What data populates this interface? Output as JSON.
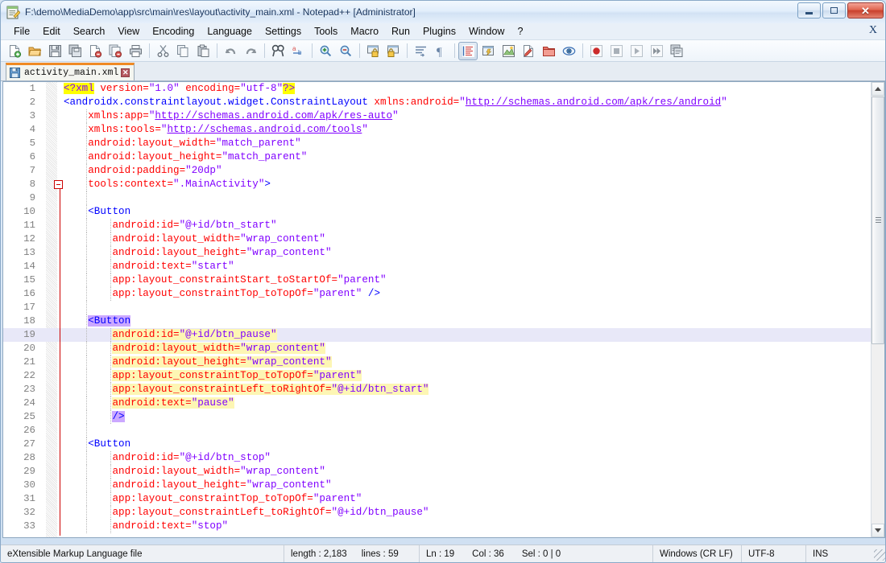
{
  "window": {
    "title": "F:\\demo\\MediaDemo\\app\\src\\main\\res\\layout\\activity_main.xml - Notepad++ [Administrator]",
    "app_icon": "notepad-plus-plus-icon",
    "minimize_label": "",
    "maximize_label": "",
    "close_label": "✕"
  },
  "menubar": {
    "items": [
      "File",
      "Edit",
      "Search",
      "View",
      "Encoding",
      "Language",
      "Settings",
      "Tools",
      "Macro",
      "Run",
      "Plugins",
      "Window",
      "?"
    ],
    "close_document_label": "X"
  },
  "toolbar": {
    "groups": [
      [
        "new-file-icon",
        "open-file-icon",
        "save-icon",
        "save-all-icon",
        "close-file-icon",
        "close-all-icon",
        "print-icon"
      ],
      [
        "cut-icon",
        "copy-icon",
        "paste-icon"
      ],
      [
        "undo-icon",
        "redo-icon"
      ],
      [
        "find-icon",
        "replace-icon"
      ],
      [
        "zoom-in-icon",
        "zoom-out-icon"
      ],
      [
        "sync-vertical-scroll-icon",
        "sync-horizontal-scroll-icon"
      ],
      [
        "word-wrap-icon",
        "show-all-characters-icon"
      ],
      [
        "show-indent-guide-icon",
        "show-ui-icon",
        "show-npp-icon",
        "macro-record-pen-icon",
        "open-folder-icon",
        "document-map-icon"
      ],
      [
        "start-recording-icon",
        "stop-recording-icon",
        "play-macro-icon",
        "run-macro-multiple-icon",
        "save-macro-icon"
      ]
    ],
    "active_button": "show-indent-guide-icon"
  },
  "tabs": [
    {
      "label": "activity_main.xml",
      "icon": "saved-file-floppy-icon",
      "close_label": "✕",
      "active": true
    }
  ],
  "editor": {
    "fold_marker_line": 8,
    "current_line": 19,
    "lines": [
      {
        "n": 1,
        "indent_guides": [],
        "tokens": [
          {
            "t": "<?",
            "c": "pi"
          },
          {
            "t": "xml",
            "c": "tag-pi"
          },
          {
            "t": " version=",
            "c": "attr"
          },
          {
            "t": "\"1.0\"",
            "c": "val"
          },
          {
            "t": " encoding=",
            "c": "attr"
          },
          {
            "t": "\"utf-8\"",
            "c": "val"
          },
          {
            "t": "?>",
            "c": "pi"
          }
        ]
      },
      {
        "n": 2,
        "indent_guides": [],
        "tokens": [
          {
            "t": "<androidx.constraintlayout.widget.ConstraintLayout",
            "c": "tag"
          },
          {
            "t": " xmlns:android=",
            "c": "attr"
          },
          {
            "t": "\"",
            "c": "val"
          },
          {
            "t": "http://schemas.android.com/apk/res/android",
            "c": "url"
          },
          {
            "t": "\"",
            "c": "val"
          }
        ]
      },
      {
        "n": 3,
        "indent_guides": [
          1
        ],
        "tokens": [
          {
            "t": "    xmlns:app=",
            "c": "attr"
          },
          {
            "t": "\"",
            "c": "val"
          },
          {
            "t": "http://schemas.android.com/apk/res-auto",
            "c": "url"
          },
          {
            "t": "\"",
            "c": "val"
          }
        ]
      },
      {
        "n": 4,
        "indent_guides": [
          1
        ],
        "tokens": [
          {
            "t": "    xmlns:tools=",
            "c": "attr"
          },
          {
            "t": "\"",
            "c": "val"
          },
          {
            "t": "http://schemas.android.com/tools",
            "c": "url"
          },
          {
            "t": "\"",
            "c": "val"
          }
        ]
      },
      {
        "n": 5,
        "indent_guides": [
          1
        ],
        "tokens": [
          {
            "t": "    android:layout_width=",
            "c": "attr"
          },
          {
            "t": "\"match_parent\"",
            "c": "val"
          }
        ]
      },
      {
        "n": 6,
        "indent_guides": [
          1
        ],
        "tokens": [
          {
            "t": "    android:layout_height=",
            "c": "attr"
          },
          {
            "t": "\"match_parent\"",
            "c": "val"
          }
        ]
      },
      {
        "n": 7,
        "indent_guides": [
          1
        ],
        "tokens": [
          {
            "t": "    android:padding=",
            "c": "attr"
          },
          {
            "t": "\"20dp\"",
            "c": "val"
          }
        ]
      },
      {
        "n": 8,
        "indent_guides": [
          1
        ],
        "fold": true,
        "tokens": [
          {
            "t": "    tools:context=",
            "c": "attr"
          },
          {
            "t": "\".MainActivity\"",
            "c": "val"
          },
          {
            "t": ">",
            "c": "tag"
          }
        ]
      },
      {
        "n": 9,
        "indent_guides": [
          1
        ],
        "tokens": []
      },
      {
        "n": 10,
        "indent_guides": [
          1
        ],
        "tokens": [
          {
            "t": "    <Button",
            "c": "tag"
          }
        ]
      },
      {
        "n": 11,
        "indent_guides": [
          1,
          2
        ],
        "tokens": [
          {
            "t": "        android:id=",
            "c": "attr"
          },
          {
            "t": "\"@+id/btn_start\"",
            "c": "val"
          }
        ]
      },
      {
        "n": 12,
        "indent_guides": [
          1,
          2
        ],
        "tokens": [
          {
            "t": "        android:layout_width=",
            "c": "attr"
          },
          {
            "t": "\"wrap_content\"",
            "c": "val"
          }
        ]
      },
      {
        "n": 13,
        "indent_guides": [
          1,
          2
        ],
        "tokens": [
          {
            "t": "        android:layout_height=",
            "c": "attr"
          },
          {
            "t": "\"wrap_content\"",
            "c": "val"
          }
        ]
      },
      {
        "n": 14,
        "indent_guides": [
          1,
          2
        ],
        "tokens": [
          {
            "t": "        android:text=",
            "c": "attr"
          },
          {
            "t": "\"start\"",
            "c": "val"
          }
        ]
      },
      {
        "n": 15,
        "indent_guides": [
          1,
          2
        ],
        "tokens": [
          {
            "t": "        app:layout_constraintStart_toStartOf=",
            "c": "attr"
          },
          {
            "t": "\"parent\"",
            "c": "val"
          }
        ]
      },
      {
        "n": 16,
        "indent_guides": [
          1,
          2
        ],
        "tokens": [
          {
            "t": "        app:layout_constraintTop_toTopOf=",
            "c": "attr"
          },
          {
            "t": "\"parent\"",
            "c": "val"
          },
          {
            "t": " />",
            "c": "tag"
          }
        ]
      },
      {
        "n": 17,
        "indent_guides": [
          1
        ],
        "tokens": []
      },
      {
        "n": 18,
        "indent_guides": [
          1
        ],
        "tokens": [
          {
            "t": "    ",
            "c": "plain"
          },
          {
            "t": "<Button",
            "c": "tag",
            "mark": "tagmatch"
          }
        ]
      },
      {
        "n": 19,
        "indent_guides": [
          1,
          2
        ],
        "current": true,
        "tokens": [
          {
            "t": "        ",
            "c": "plain"
          },
          {
            "t": "android:id=",
            "c": "attr",
            "mark": "hl"
          },
          {
            "t": "\"@+id/btn_pause\"",
            "c": "val",
            "mark": "hl"
          }
        ]
      },
      {
        "n": 20,
        "indent_guides": [
          1,
          2
        ],
        "tokens": [
          {
            "t": "        ",
            "c": "plain"
          },
          {
            "t": "android:layout_width=",
            "c": "attr",
            "mark": "hl"
          },
          {
            "t": "\"wrap_content\"",
            "c": "val",
            "mark": "hl"
          }
        ]
      },
      {
        "n": 21,
        "indent_guides": [
          1,
          2
        ],
        "tokens": [
          {
            "t": "        ",
            "c": "plain"
          },
          {
            "t": "android:layout_height=",
            "c": "attr",
            "mark": "hl"
          },
          {
            "t": "\"wrap_content\"",
            "c": "val",
            "mark": "hl"
          }
        ]
      },
      {
        "n": 22,
        "indent_guides": [
          1,
          2
        ],
        "tokens": [
          {
            "t": "        ",
            "c": "plain"
          },
          {
            "t": "app:layout_constraintTop_toTopOf=",
            "c": "attr",
            "mark": "hl"
          },
          {
            "t": "\"parent\"",
            "c": "val",
            "mark": "hl"
          }
        ]
      },
      {
        "n": 23,
        "indent_guides": [
          1,
          2
        ],
        "tokens": [
          {
            "t": "        ",
            "c": "plain"
          },
          {
            "t": "app:layout_constraintLeft_toRightOf=",
            "c": "attr",
            "mark": "hl"
          },
          {
            "t": "\"@+id/btn_start\"",
            "c": "val",
            "mark": "hl"
          }
        ]
      },
      {
        "n": 24,
        "indent_guides": [
          1,
          2
        ],
        "tokens": [
          {
            "t": "        ",
            "c": "plain"
          },
          {
            "t": "android:text=",
            "c": "attr",
            "mark": "hl"
          },
          {
            "t": "\"pause\"",
            "c": "val",
            "mark": "hl"
          }
        ]
      },
      {
        "n": 25,
        "indent_guides": [
          1,
          2
        ],
        "tokens": [
          {
            "t": "        ",
            "c": "plain"
          },
          {
            "t": "/>",
            "c": "tag",
            "mark": "tagmatch"
          }
        ]
      },
      {
        "n": 26,
        "indent_guides": [
          1
        ],
        "tokens": []
      },
      {
        "n": 27,
        "indent_guides": [
          1
        ],
        "tokens": [
          {
            "t": "    <Button",
            "c": "tag"
          }
        ]
      },
      {
        "n": 28,
        "indent_guides": [
          1,
          2
        ],
        "tokens": [
          {
            "t": "        android:id=",
            "c": "attr"
          },
          {
            "t": "\"@+id/btn_stop\"",
            "c": "val"
          }
        ]
      },
      {
        "n": 29,
        "indent_guides": [
          1,
          2
        ],
        "tokens": [
          {
            "t": "        android:layout_width=",
            "c": "attr"
          },
          {
            "t": "\"wrap_content\"",
            "c": "val"
          }
        ]
      },
      {
        "n": 30,
        "indent_guides": [
          1,
          2
        ],
        "tokens": [
          {
            "t": "        android:layout_height=",
            "c": "attr"
          },
          {
            "t": "\"wrap_content\"",
            "c": "val"
          }
        ]
      },
      {
        "n": 31,
        "indent_guides": [
          1,
          2
        ],
        "tokens": [
          {
            "t": "        app:layout_constraintTop_toTopOf=",
            "c": "attr"
          },
          {
            "t": "\"parent\"",
            "c": "val"
          }
        ]
      },
      {
        "n": 32,
        "indent_guides": [
          1,
          2
        ],
        "tokens": [
          {
            "t": "        app:layout_constraintLeft_toRightOf=",
            "c": "attr"
          },
          {
            "t": "\"@+id/btn_pause\"",
            "c": "val"
          }
        ]
      },
      {
        "n": 33,
        "indent_guides": [
          1,
          2
        ],
        "tokens": [
          {
            "t": "        android:text=",
            "c": "attr"
          },
          {
            "t": "\"stop\"",
            "c": "val"
          }
        ]
      }
    ]
  },
  "statusbar": {
    "file_type": "eXtensible Markup Language file",
    "length_label": "length : 2,183",
    "lines_label": "lines : 59",
    "ln_label": "Ln : 19",
    "col_label": "Col : 36",
    "sel_label": "Sel : 0 | 0",
    "eol": "Windows (CR LF)",
    "encoding": "UTF-8",
    "insert_mode": "INS"
  },
  "colors": {
    "tag": "#0000ff",
    "attribute": "#ff0000",
    "value": "#8000ff",
    "smart_highlight": "#fdf6b4",
    "tag_match": "#cba8ff",
    "current_line": "#e8e8f8",
    "pi_highlight": "#ffff00",
    "fold_line": "#cc0000",
    "tab_active_border": "#f08a24"
  }
}
